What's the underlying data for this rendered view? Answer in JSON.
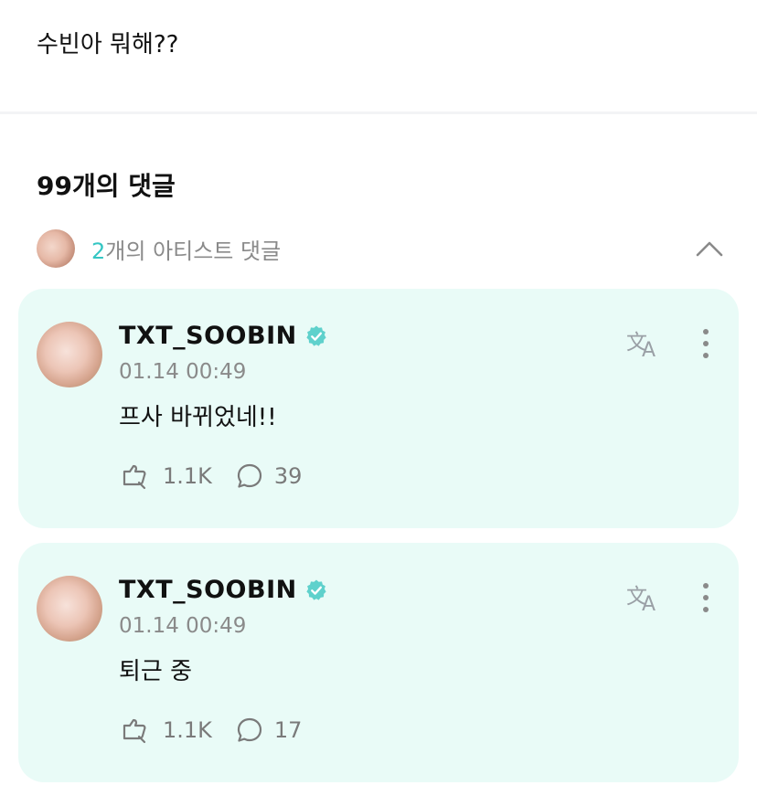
{
  "post": {
    "text": "수빈아 뭐해??"
  },
  "comments_header": {
    "count_label": "99개의 댓글"
  },
  "artist_comments": {
    "count": "2",
    "label_rest": "개의 아티스트 댓글"
  },
  "comments": [
    {
      "username": "TXT_SOOBIN",
      "time": "01.14 00:49",
      "text": "프사 바뀌었네!!",
      "likes": "1.1K",
      "replies": "39"
    },
    {
      "username": "TXT_SOOBIN",
      "time": "01.14 00:49",
      "text": "퇴근 중",
      "likes": "1.1K",
      "replies": "17"
    }
  ],
  "colors": {
    "accent": "#34c6c3",
    "card_bg": "#e9fbf7",
    "verified": "#5fd1cc"
  },
  "icons": [
    "chevron-up-icon",
    "verified-icon",
    "translate-icon",
    "more-icon",
    "like-icon",
    "reply-icon"
  ]
}
